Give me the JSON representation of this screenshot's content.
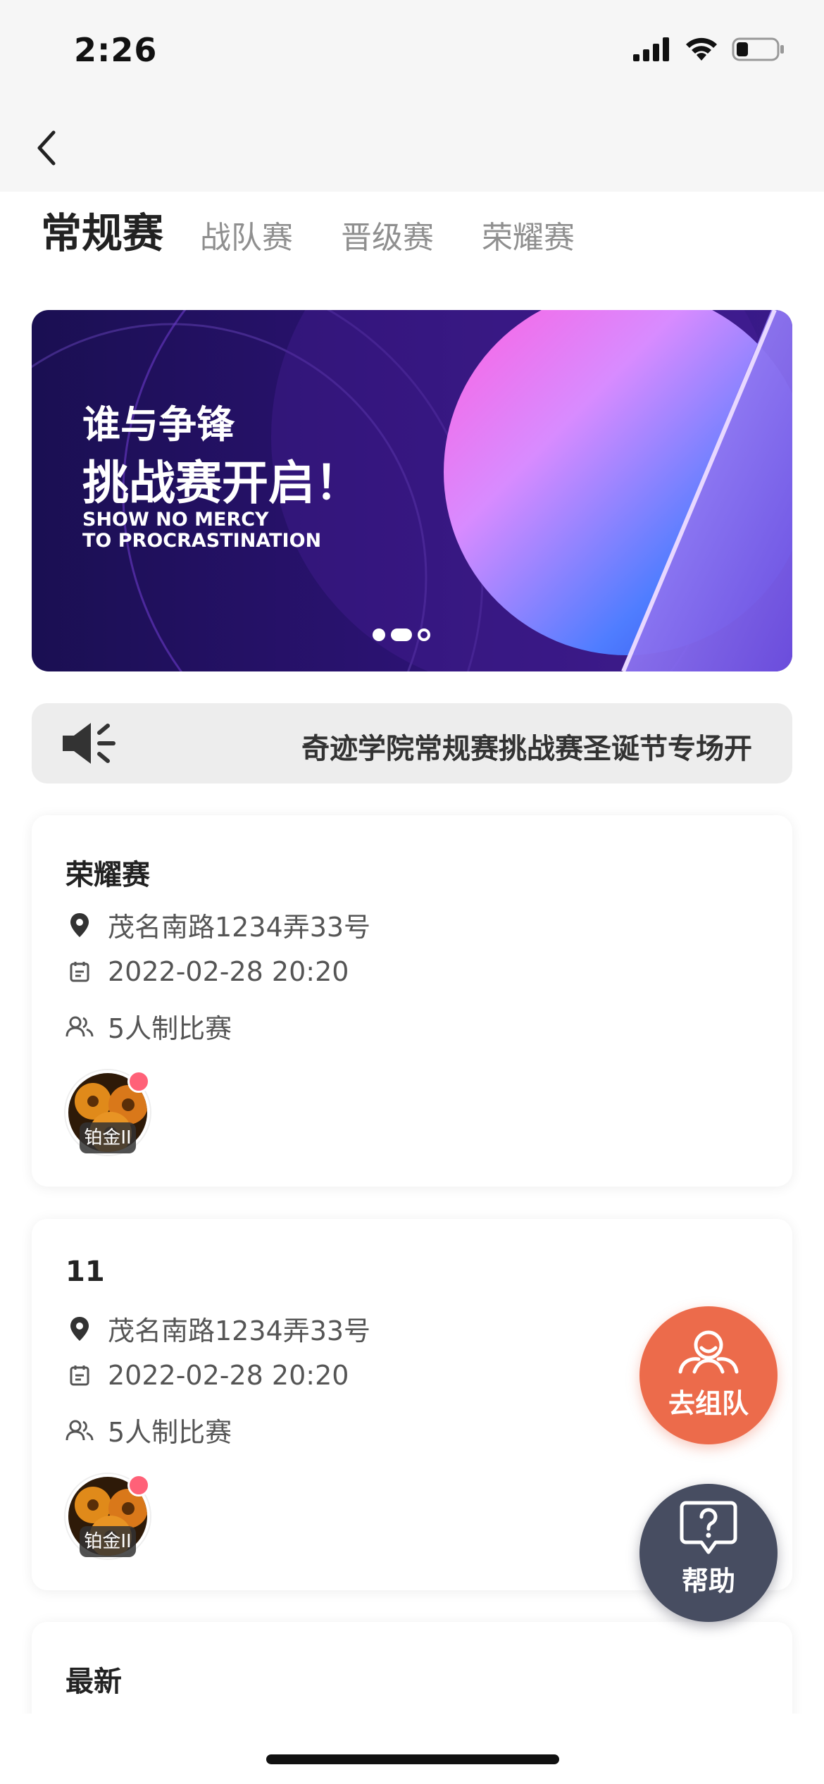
{
  "status_bar": {
    "time": "2:26"
  },
  "tabs": [
    {
      "label": "常规赛",
      "active": true
    },
    {
      "label": "战队赛",
      "active": false
    },
    {
      "label": "晋级赛",
      "active": false
    },
    {
      "label": "荣耀赛",
      "active": false
    }
  ],
  "banner": {
    "title_line1": "谁与争锋",
    "title_line2": "挑战赛开启！",
    "subtitle_line1": "SHOW NO MERCY",
    "subtitle_line2": "TO PROCRASTINATION",
    "carousel_total": 3,
    "carousel_active_index": 1
  },
  "notice": {
    "text": "奇迹学院常规赛挑战赛圣诞节专场开"
  },
  "cards": [
    {
      "title": "荣耀赛",
      "address": "茂名南路1234弄33号",
      "datetime": "2022-02-28 20:20",
      "format": "5人制比赛",
      "rank": "铂金II"
    },
    {
      "title": "11",
      "address": "茂名南路1234弄33号",
      "datetime": "2022-02-28 20:20",
      "format": "5人制比赛",
      "rank": "铂金II"
    }
  ],
  "card3": {
    "title": "最新"
  },
  "fab": {
    "team_label": "去组队",
    "help_label": "帮助"
  },
  "colors": {
    "accent_orange": "#ec6b4b",
    "help_dark": "#474d61",
    "badge_pink": "#ff6178"
  }
}
